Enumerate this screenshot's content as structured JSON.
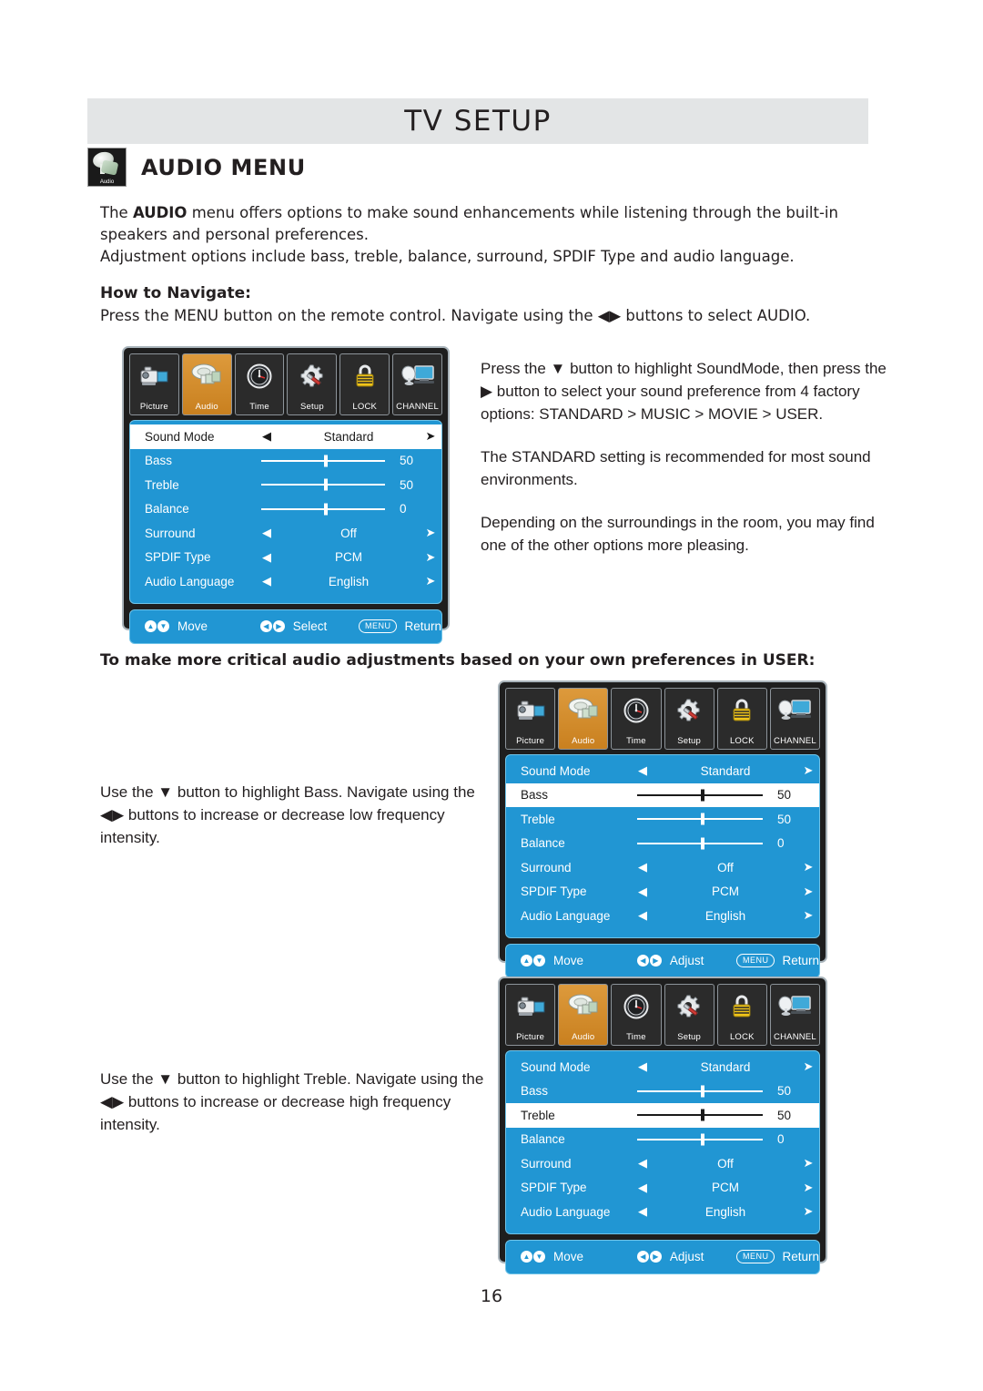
{
  "header": {
    "title": "TV SETUP"
  },
  "section": {
    "icon": "audio-speaker-icon",
    "badge_label": "Audio",
    "title": "AUDIO MENU"
  },
  "body": {
    "intro_line1_pre": "The ",
    "intro_bold": "AUDIO",
    "intro_line1_post": " menu offers options to make sound enhancements while listening through the built-in speakers and personal preferences.",
    "intro_line2": "Adjustment options include bass, treble, balance, surround, SPDIF Type and audio language.",
    "howto_label": "How to Navigate:",
    "howto_text": "Press the MENU button on the remote control. Navigate using the ◀▶ buttons to select AUDIO.",
    "critical_heading": "To make more critical audio adjustments based on your own preferences in USER:"
  },
  "side_text_1": {
    "p1": "Press the ▼ button to highlight SoundMode, then press the ▶ button to select your sound preference from 4 factory options: STANDARD > MUSIC > MOVIE > USER.",
    "p2": "The STANDARD setting is recommended for most sound environments.",
    "p3": "Depending on the surroundings in the room, you may find one of the other options more pleasing."
  },
  "side_text_2": {
    "text": "Use the ▼ button to highlight Bass. Navigate using the ◀▶ buttons to increase or decrease low frequency intensity."
  },
  "side_text_3": {
    "text": "Use the ▼ button to highlight Treble. Navigate using the ◀▶ buttons to increase or decrease high frequency intensity."
  },
  "osd_tabs": [
    {
      "label": "Picture",
      "icon": "camcorder-icon",
      "active": false
    },
    {
      "label": "Audio",
      "icon": "audio-speaker-icon",
      "active": true
    },
    {
      "label": "Time",
      "icon": "clock-icon",
      "active": false
    },
    {
      "label": "Setup",
      "icon": "gear-screwdriver-icon",
      "active": false
    },
    {
      "label": "LOCK",
      "icon": "padlock-icon",
      "active": false
    },
    {
      "label": "CHANNEL",
      "icon": "satellite-tv-icon",
      "active": false
    }
  ],
  "menu_rows": {
    "sound_mode": {
      "label": "Sound Mode",
      "value": "Standard",
      "type": "selector"
    },
    "bass": {
      "label": "Bass",
      "value": "50",
      "type": "slider",
      "percent": 50
    },
    "treble": {
      "label": "Treble",
      "value": "50",
      "type": "slider",
      "percent": 50
    },
    "balance": {
      "label": "Balance",
      "value": "0",
      "type": "slider",
      "percent": 50
    },
    "surround": {
      "label": "Surround",
      "value": "Off",
      "type": "selector"
    },
    "spdif": {
      "label": "SPDIF Type",
      "value": "PCM",
      "type": "selector"
    },
    "audio_language": {
      "label": "Audio Language",
      "value": "English",
      "type": "selector"
    }
  },
  "arrows": {
    "left": "◀",
    "right": "➤"
  },
  "osd_panels": [
    {
      "selected_row": "sound_mode",
      "footer": {
        "move": "Move",
        "middle": "Select",
        "menu_pill": "MENU",
        "return": "Return"
      }
    },
    {
      "selected_row": "bass",
      "footer": {
        "move": "Move",
        "middle": "Adjust",
        "menu_pill": "MENU",
        "return": "Return"
      }
    },
    {
      "selected_row": "treble",
      "footer": {
        "move": "Move",
        "middle": "Adjust",
        "menu_pill": "MENU",
        "return": "Return"
      }
    }
  ],
  "footer_icons": {
    "up": "▲",
    "down": "▼",
    "left": "◀",
    "right": "▶"
  },
  "page": {
    "number": "16"
  },
  "colors": {
    "osd_blue": "#2196d3",
    "tab_active": "#d3882c",
    "header_gray": "#e3e5e6",
    "panel_dark": "#1e1e1e"
  }
}
